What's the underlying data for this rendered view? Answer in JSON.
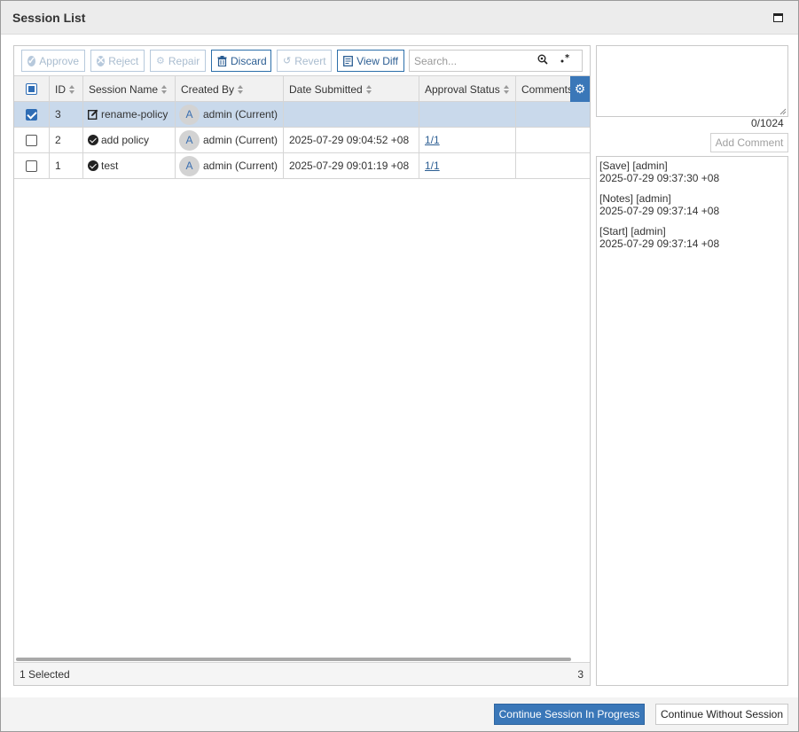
{
  "dialog": {
    "title": "Session List"
  },
  "toolbar": {
    "approve": "Approve",
    "reject": "Reject",
    "repair": "Repair",
    "discard": "Discard",
    "revert": "Revert",
    "view_diff": "View Diff",
    "search_placeholder": "Search..."
  },
  "table": {
    "columns": [
      "ID",
      "Session Name",
      "Created By",
      "Date Submitted",
      "Approval Status",
      "Comments"
    ],
    "rows": [
      {
        "id": "3",
        "name": "rename-policy",
        "name_icon": "edit-icon",
        "avatar": "A",
        "created_by": "admin (Current)",
        "date": "",
        "approval": "",
        "comments": "",
        "selected": true
      },
      {
        "id": "2",
        "name": "add policy",
        "name_icon": "check-circle-icon",
        "avatar": "A",
        "created_by": "admin (Current)",
        "date": "2025-07-29 09:04:52 +08",
        "approval": "1/1",
        "comments": "",
        "selected": false
      },
      {
        "id": "1",
        "name": "test",
        "name_icon": "check-circle-icon",
        "avatar": "A",
        "created_by": "admin (Current)",
        "date": "2025-07-29 09:01:19 +08",
        "approval": "1/1",
        "comments": "",
        "selected": false
      }
    ],
    "footer_selected": "1 Selected",
    "footer_count": "3"
  },
  "comments": {
    "textarea_value": "",
    "counter": "0/1024",
    "add_comment": "Add Comment",
    "log": [
      {
        "header": "[Save] [admin]",
        "time": "2025-07-29 09:37:30 +08"
      },
      {
        "header": "[Notes] [admin]",
        "time": "2025-07-29 09:37:14 +08"
      },
      {
        "header": "[Start] [admin]",
        "time": "2025-07-29 09:37:14 +08"
      }
    ]
  },
  "actions": {
    "continue_in_progress": "Continue Session In Progress",
    "continue_without": "Continue Without Session"
  },
  "colors": {
    "accent": "#3a77b8",
    "selected_row": "#c9d9eb",
    "link": "#2c5e93"
  }
}
